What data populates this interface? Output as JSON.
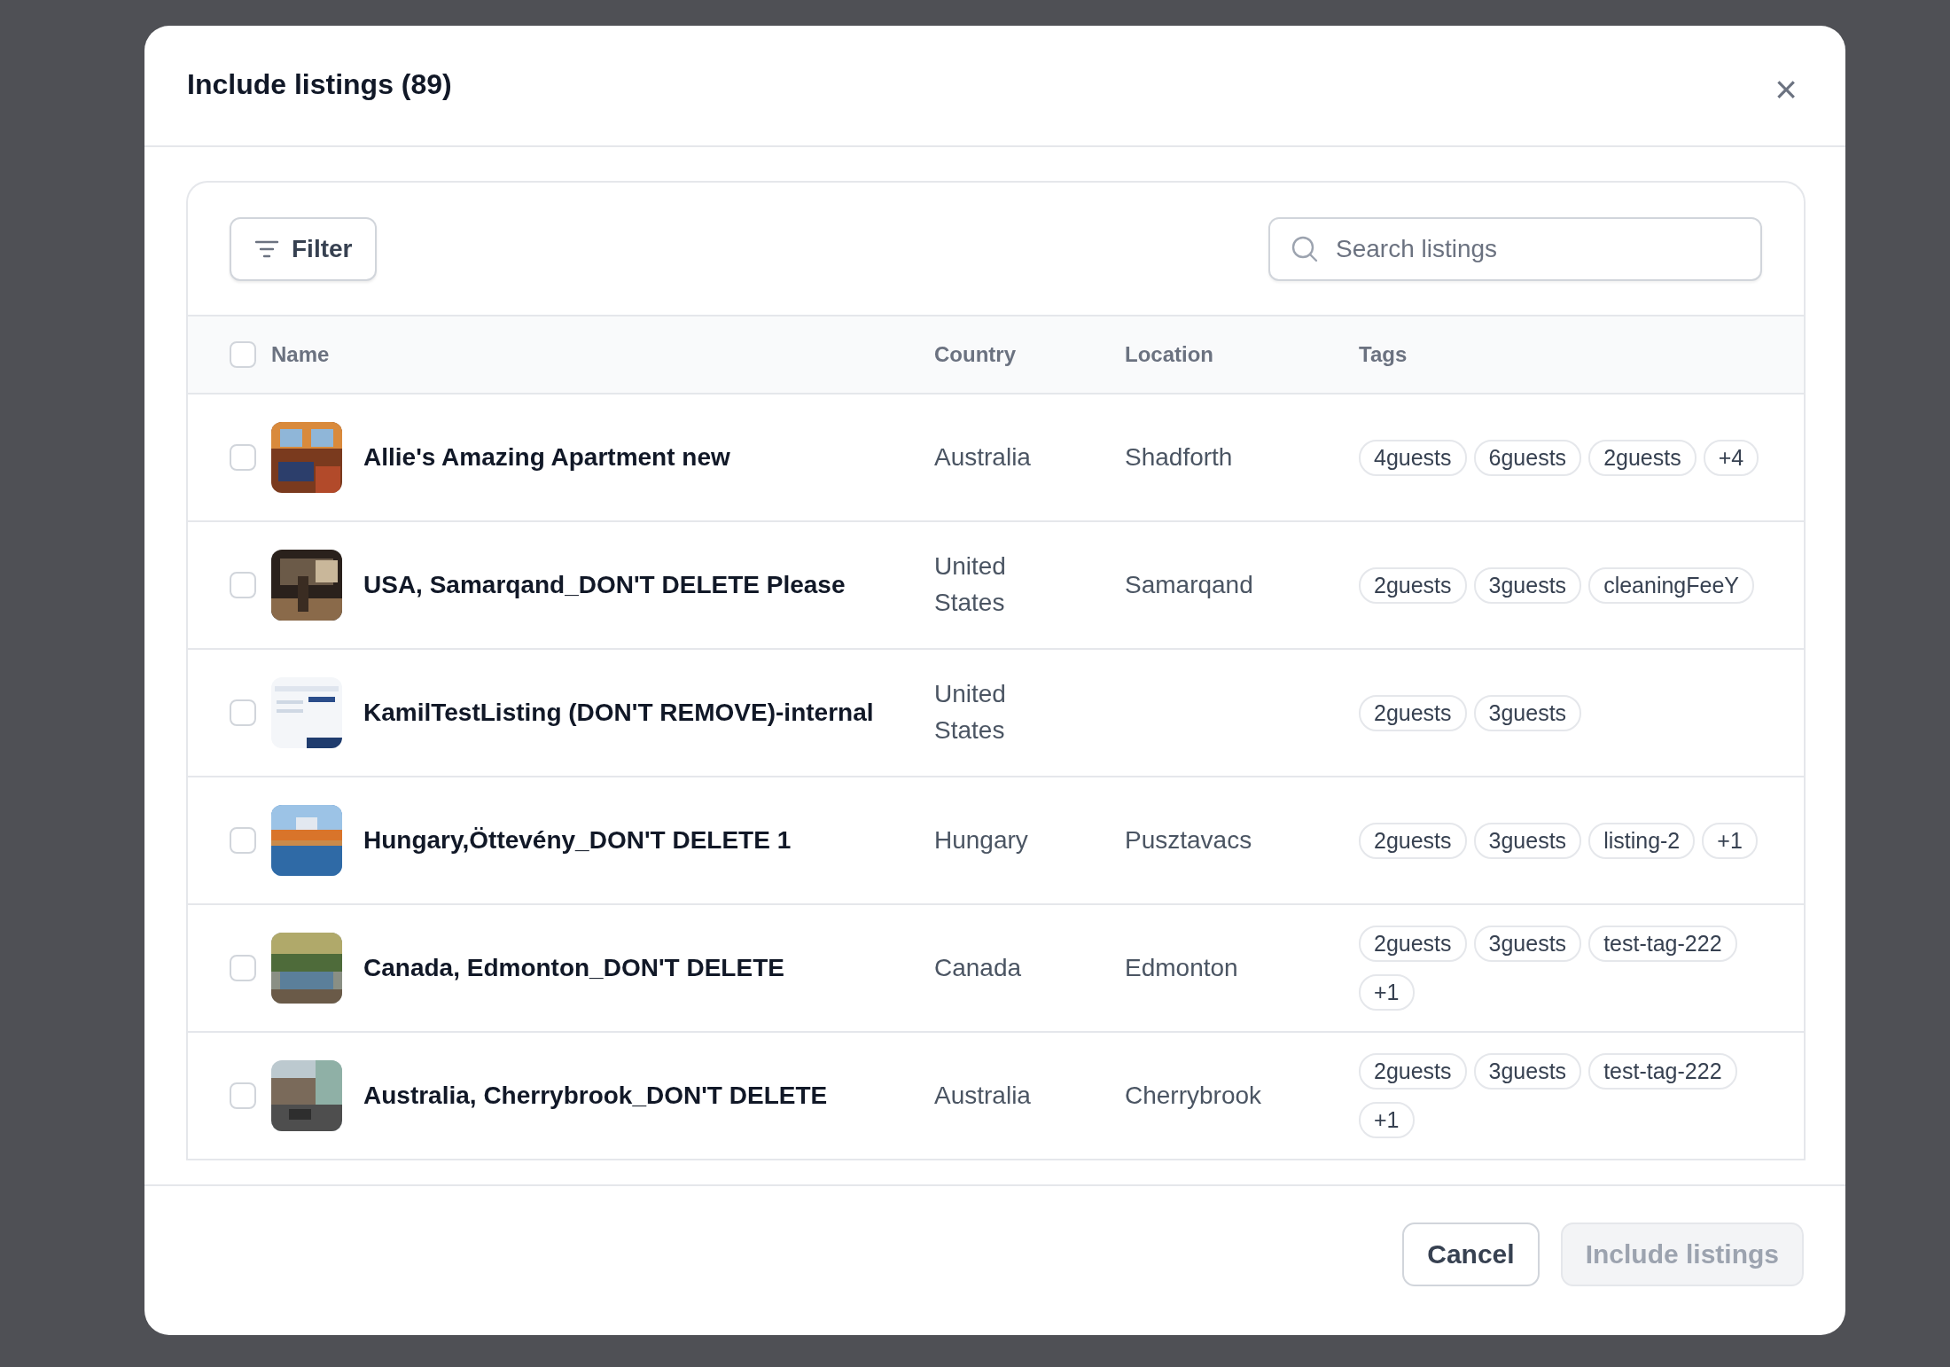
{
  "dialog": {
    "title": "Include listings (89)",
    "close_label": "×"
  },
  "toolbar": {
    "filter_button": "Filter",
    "search": {
      "placeholder": "Search listings"
    }
  },
  "table": {
    "select_all": {
      "checked": false
    },
    "columns": [
      "Name",
      "Country",
      "Location",
      "Tags"
    ],
    "rows": [
      {
        "checked": false,
        "name": "Allie's Amazing Apartment new",
        "country": "Australia",
        "location": "Shadforth",
        "tags": [
          "4guests",
          "6guests",
          "2guests",
          "+4"
        ]
      },
      {
        "checked": false,
        "name": "USA, Samarqand_DON'T DELETE Please",
        "country": "United States",
        "location": "Samarqand",
        "tags": [
          "2guests",
          "3guests",
          "cleaningFeeY"
        ]
      },
      {
        "checked": false,
        "name": "KamilTestListing (DON'T REMOVE)-internal",
        "country": "United States",
        "location": "",
        "tags": [
          "2guests",
          "3guests"
        ]
      },
      {
        "checked": false,
        "name": "Hungary,Öttevény_DON'T DELETE 1",
        "country": "Hungary",
        "location": "Pusztavacs",
        "tags": [
          "2guests",
          "3guests",
          "listing-2",
          "+1"
        ]
      },
      {
        "checked": false,
        "name": "Canada, Edmonton_DON'T DELETE",
        "country": "Canada",
        "location": "Edmonton",
        "tags": [
          "2guests",
          "3guests",
          "test-tag-222",
          "+1"
        ]
      },
      {
        "checked": false,
        "name": "Australia, Cherrybrook_DON'T DELETE",
        "country": "Australia",
        "location": "Cherrybrook",
        "tags": [
          "2guests",
          "3guests",
          "test-tag-222",
          "+1"
        ]
      }
    ]
  },
  "footer": {
    "cancel_button": "Cancel",
    "confirm_button": {
      "label": "Include listings",
      "disabled": true
    }
  }
}
